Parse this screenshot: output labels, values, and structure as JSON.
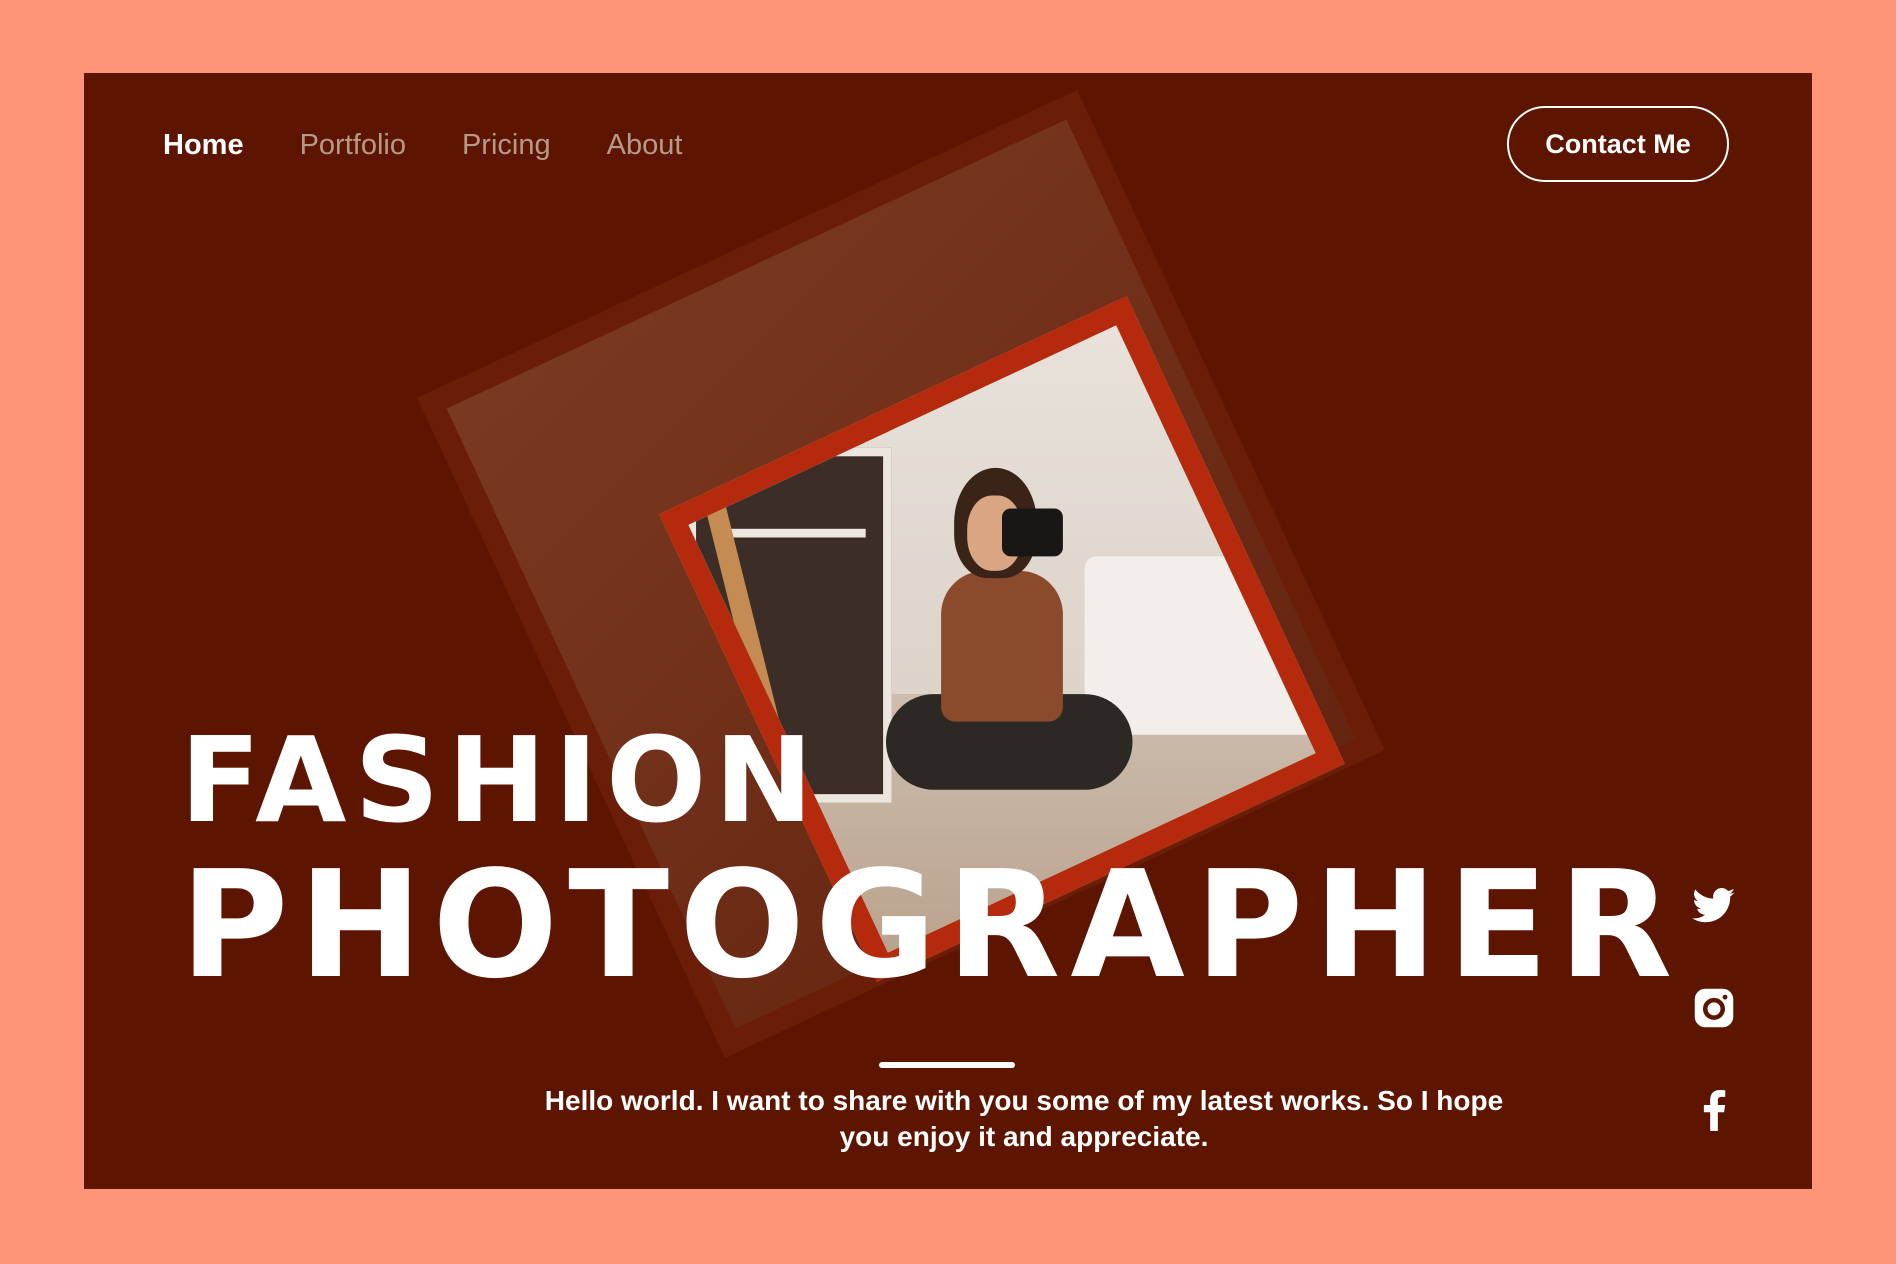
{
  "nav": {
    "items": [
      {
        "label": "Home",
        "active": true
      },
      {
        "label": "Portfolio",
        "active": false
      },
      {
        "label": "Pricing",
        "active": false
      },
      {
        "label": "About",
        "active": false
      }
    ],
    "contact_label": "Contact Me"
  },
  "hero": {
    "title_line1": "FASHION",
    "title_line2": "PHOTOGRAPHER",
    "tagline_line1": "Hello world. I want to share with you some of my latest works. So I hope",
    "tagline_line2": "you enjoy it and appreciate."
  },
  "social": [
    "twitter-icon",
    "instagram-icon",
    "facebook-icon"
  ],
  "colors": {
    "page_bg": "#FF9577",
    "panel_bg": "#5E1500",
    "frame_accent": "#B52A0C",
    "nav_inactive": "#B59A8A",
    "text": "#FFFFFF"
  }
}
